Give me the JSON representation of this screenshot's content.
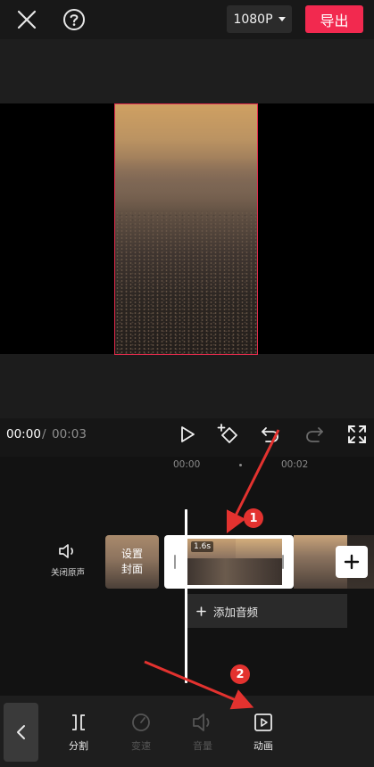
{
  "header": {
    "resolution_label": "1080P",
    "export_label": "导出"
  },
  "playback": {
    "current_time": "00:00",
    "separator": "/",
    "total_time": "00:03"
  },
  "timeline": {
    "ruler_labels": [
      "00:00",
      "00:02"
    ],
    "mute_label": "关闭原声",
    "cover_label_line1": "设置",
    "cover_label_line2": "封面",
    "clip_duration": "1.6s",
    "add_audio_label": "添加音频"
  },
  "toolbar": {
    "tools": [
      {
        "label": "分割",
        "icon": "split-icon",
        "enabled": true
      },
      {
        "label": "变速",
        "icon": "speed-icon",
        "enabled": false
      },
      {
        "label": "音量",
        "icon": "volume-icon",
        "enabled": false
      },
      {
        "label": "动画",
        "icon": "animation-icon",
        "enabled": true
      }
    ]
  },
  "annotations": {
    "step1": "1",
    "step2": "2"
  },
  "colors": {
    "accent": "#f2294f",
    "annotation_red": "#e3322f",
    "frame_border": "#e12b4c"
  }
}
